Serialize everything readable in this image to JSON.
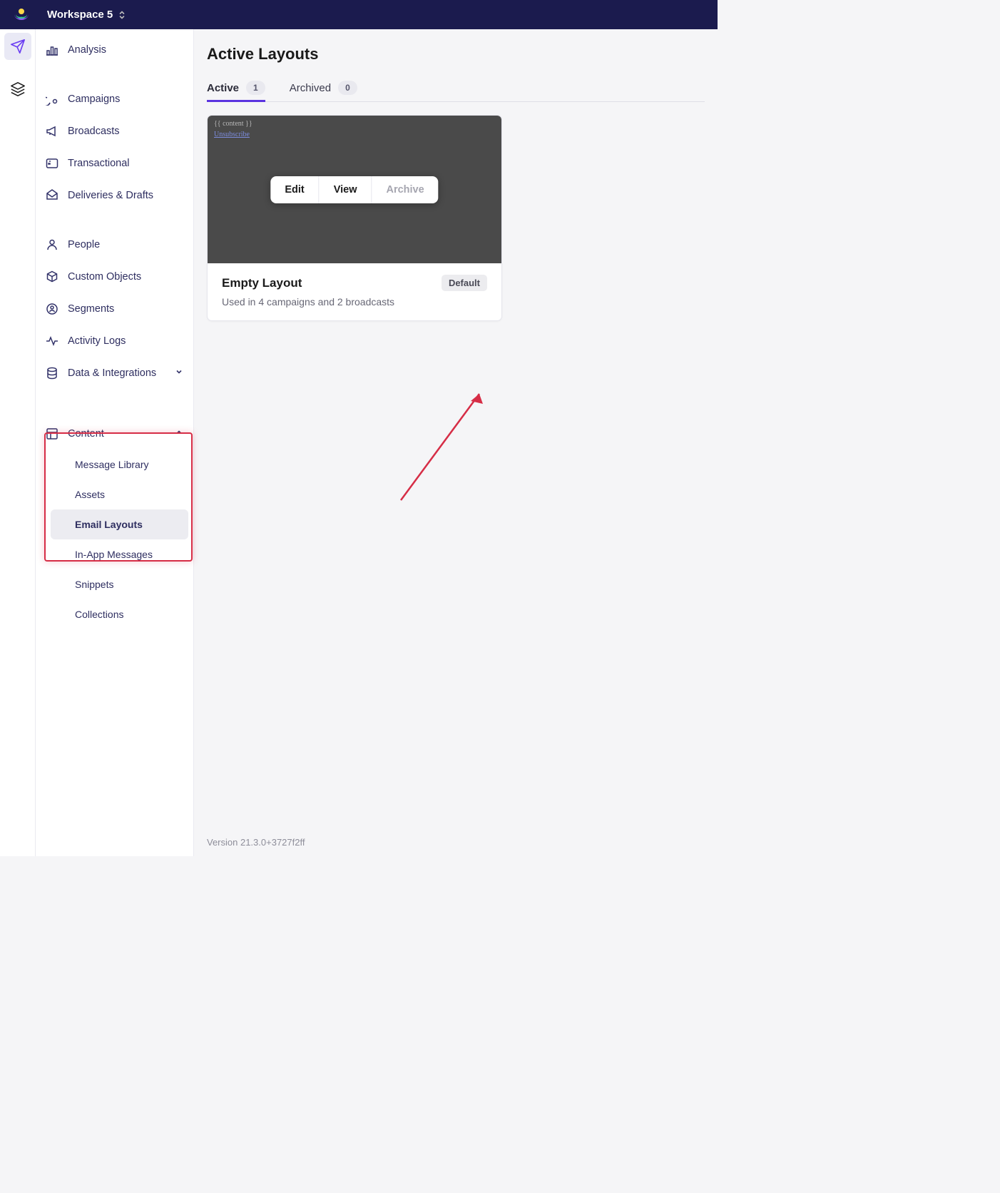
{
  "topbar": {
    "workspace": "Workspace 5"
  },
  "sidebar": {
    "analysis": "Analysis",
    "campaigns": "Campaigns",
    "broadcasts": "Broadcasts",
    "transactional": "Transactional",
    "deliveries": "Deliveries & Drafts",
    "people": "People",
    "custom_objects": "Custom Objects",
    "segments": "Segments",
    "activity_logs": "Activity Logs",
    "data_integrations": "Data & Integrations",
    "content": "Content",
    "message_library": "Message Library",
    "assets": "Assets",
    "email_layouts": "Email Layouts",
    "in_app_messages": "In-App Messages",
    "snippets": "Snippets",
    "collections": "Collections"
  },
  "page": {
    "title": "Active Layouts",
    "tabs": {
      "active": {
        "label": "Active",
        "count": "1"
      },
      "archived": {
        "label": "Archived",
        "count": "0"
      }
    },
    "preview": {
      "content": "{{ content }}",
      "unsubscribe": "Unsubscribe"
    },
    "actions": {
      "edit": "Edit",
      "view": "View",
      "archive": "Archive"
    },
    "layout": {
      "name": "Empty Layout",
      "badge": "Default",
      "usage": "Used in 4 campaigns and 2 broadcasts"
    },
    "version": "Version 21.3.0+3727f2ff"
  }
}
